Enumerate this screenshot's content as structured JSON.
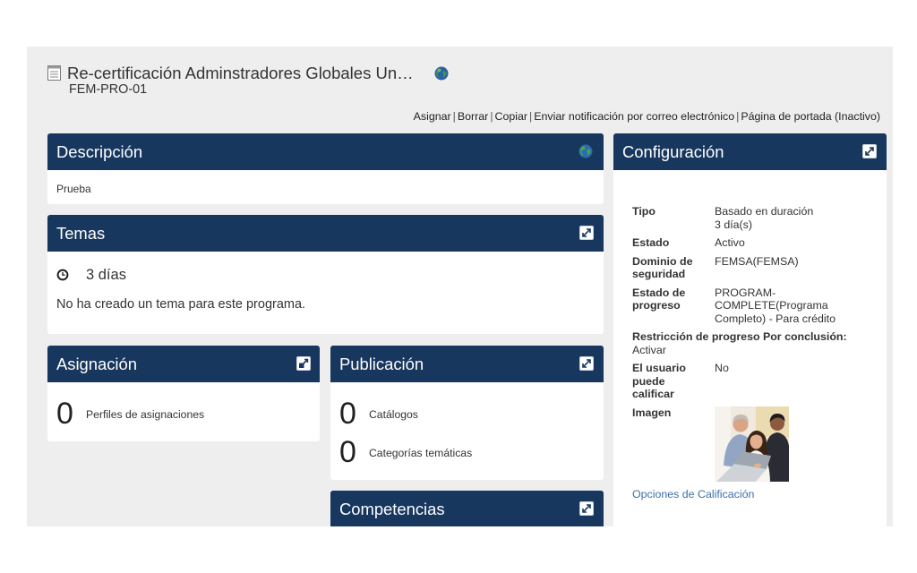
{
  "header": {
    "title": "Re-certificación Adminstradores Globales Un…",
    "code": "FEM-PRO-01",
    "title_icon": "document-icon",
    "language_icon": "globe-icon"
  },
  "actions": {
    "separator": "|",
    "items": [
      {
        "label": "Asignar"
      },
      {
        "label": "Borrar"
      },
      {
        "label": "Copiar"
      },
      {
        "label": "Enviar notificación por correo electrónico"
      },
      {
        "label": "Página de portada (Inactivo)"
      }
    ]
  },
  "description": {
    "title": "Descripción",
    "icon": "globe-icon",
    "text": "Prueba"
  },
  "topics": {
    "title": "Temas",
    "icon": "edit-icon",
    "duration_icon": "clock-icon",
    "duration": "3 días",
    "empty_message": "No ha creado un tema para este programa."
  },
  "assignment": {
    "title": "Asignación",
    "icon": "expand-icon",
    "items": [
      {
        "count": "0",
        "label": "Perfiles de asignaciones"
      }
    ]
  },
  "publication": {
    "title": "Publicación",
    "icon": "edit-icon",
    "items": [
      {
        "count": "0",
        "label": "Catálogos"
      },
      {
        "count": "0",
        "label": "Categorías temáticas"
      }
    ]
  },
  "competencies": {
    "title": "Competencias",
    "icon": "edit-icon"
  },
  "configuration": {
    "title": "Configuración",
    "icon": "edit-icon",
    "type": {
      "label": "Tipo",
      "value": "Basado en duración",
      "detail": "3 día(s)"
    },
    "status": {
      "label": "Estado",
      "value": "Activo"
    },
    "security_domain": {
      "label": "Dominio de seguridad",
      "value": "FEMSA(FEMSA)"
    },
    "progress_state": {
      "label": "Estado de progreso",
      "value": "PROGRAM-COMPLETE(Programa Completo) - Para crédito"
    },
    "progress_restriction": {
      "label": "Restricción de progreso Por conclusión:",
      "value": "Activar"
    },
    "user_can_rate": {
      "label": "El usuario puede calificar",
      "value": "No"
    },
    "image": {
      "label": "Imagen"
    },
    "grading_link": "Opciones de Calificación"
  },
  "colors": {
    "header_bg": "#17375e",
    "page_bg": "#eeeeee",
    "panel_bg": "#ffffff",
    "text": "#333333",
    "link": "#3d6fa8"
  }
}
